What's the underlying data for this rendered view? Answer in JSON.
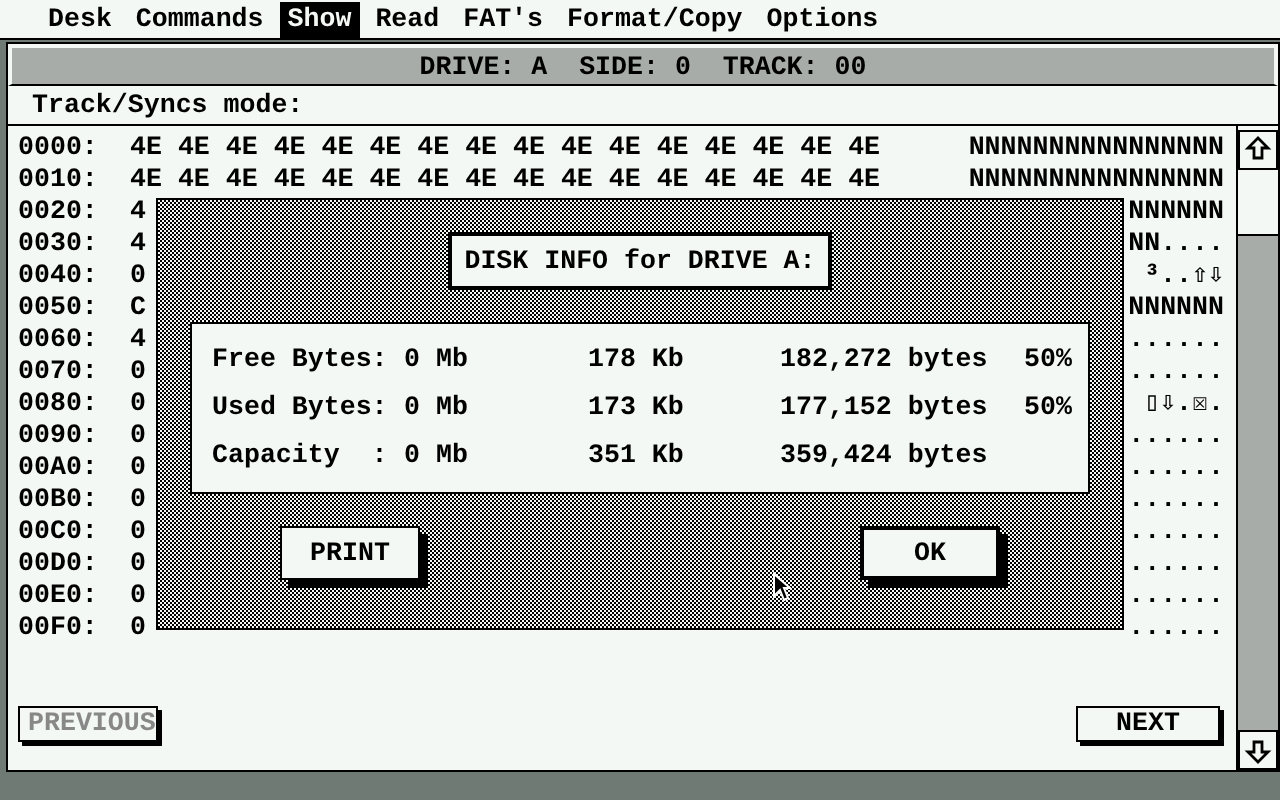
{
  "menu": [
    {
      "label": "Desk",
      "selected": false
    },
    {
      "label": "Commands",
      "selected": false
    },
    {
      "label": "Show",
      "selected": true
    },
    {
      "label": "Read",
      "selected": false
    },
    {
      "label": "FAT's",
      "selected": false
    },
    {
      "label": "Format/Copy",
      "selected": false
    },
    {
      "label": "Options",
      "selected": false
    }
  ],
  "window": {
    "title": "DRIVE: A  SIDE: 0  TRACK: 00",
    "info": "Track/Syncs mode:"
  },
  "dump_rows": [
    {
      "address": "0000:",
      "hex": "4E 4E 4E 4E 4E 4E 4E 4E 4E 4E 4E 4E 4E 4E 4E 4E",
      "ascii": "NNNNNNNNNNNNNNNN"
    },
    {
      "address": "0010:",
      "hex": "4E 4E 4E 4E 4E 4E 4E 4E 4E 4E 4E 4E 4E 4E 4E 4E",
      "ascii": "NNNNNNNNNNNNNNNN"
    },
    {
      "address": "0020:",
      "hex": "4",
      "ascii": "NNNNNN"
    },
    {
      "address": "0030:",
      "hex": "4",
      "ascii": "NN...."
    },
    {
      "address": "0040:",
      "hex": "0",
      "ascii": "³..⇧⇩"
    },
    {
      "address": "0050:",
      "hex": "C",
      "ascii": "NNNNNN"
    },
    {
      "address": "0060:",
      "hex": "4",
      "ascii": "......"
    },
    {
      "address": "0070:",
      "hex": "0",
      "ascii": "......"
    },
    {
      "address": "0080:",
      "hex": "0",
      "ascii": "▯⇩.☒."
    },
    {
      "address": "0090:",
      "hex": "0",
      "ascii": "......"
    },
    {
      "address": "00A0:",
      "hex": "0",
      "ascii": "......"
    },
    {
      "address": "00B0:",
      "hex": "0",
      "ascii": "......"
    },
    {
      "address": "00C0:",
      "hex": "0",
      "ascii": "......"
    },
    {
      "address": "00D0:",
      "hex": "0",
      "ascii": "......"
    },
    {
      "address": "00E0:",
      "hex": "0",
      "ascii": "......"
    },
    {
      "address": "00F0:",
      "hex": "0",
      "ascii": "......"
    }
  ],
  "buttons": [
    {
      "label": "PREVIOUS",
      "disabled": true
    },
    {
      "label": "NEXT",
      "disabled": false
    }
  ],
  "dialog": {
    "title": "DISK INFO for DRIVE A:",
    "rows": [
      {
        "label": "Free Bytes:",
        "mb": "0 Mb",
        "kb": "178 Kb",
        "bytes": "182,272 bytes",
        "percent": "50%"
      },
      {
        "label": "Used Bytes:",
        "mb": "0 Mb",
        "kb": "173 Kb",
        "bytes": "177,152 bytes",
        "percent": "50%"
      },
      {
        "label": "Capacity  :",
        "mb": "0 Mb",
        "kb": "351 Kb",
        "bytes": "359,424 bytes"
      }
    ],
    "buttons": [
      {
        "label": "PRINT",
        "default": false
      },
      {
        "label": "OK",
        "default": true
      }
    ]
  }
}
